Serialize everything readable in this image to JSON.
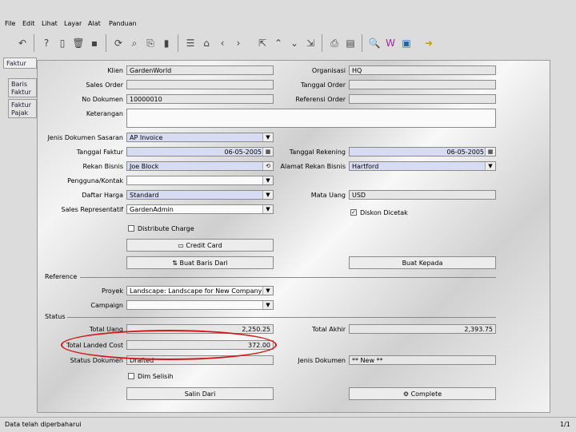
{
  "menu": [
    "File",
    "Edit",
    "Lihat",
    "Layar",
    "Alat",
    "Panduan"
  ],
  "toolbar_icons": [
    "undo-icon",
    "help-icon",
    "new-icon",
    "delete-icon",
    "save-icon",
    "refresh-icon",
    "find-icon",
    "attachment-icon",
    "history-icon",
    "report-icon",
    "archive-icon",
    "previous-icon",
    "parent-icon",
    "up-icon",
    "down-icon",
    "detail-icon",
    "print-icon",
    "print-preview-icon",
    "zoom-icon",
    "workflow-icon",
    "request-icon",
    "exit-icon"
  ],
  "tabs": [
    "Faktur",
    "Baris Faktur",
    "Faktur Pajak"
  ],
  "form": {
    "klien_label": "Klien",
    "klien": "GardenWorld",
    "organisasi_label": "Organisasi",
    "organisasi": "HQ",
    "sales_order_label": "Sales Order",
    "sales_order": "",
    "tanggal_order_label": "Tanggal Order",
    "tanggal_order": "",
    "no_dokumen_label": "No Dokumen",
    "no_dokumen": "10000010",
    "referensi_order_label": "Referensi Order",
    "referensi_order": "",
    "keterangan_label": "Keterangan",
    "keterangan": "",
    "jenis_dokumen_sasaran_label": "Jenis Dokumen Sasaran",
    "jenis_dokumen_sasaran": "AP Invoice",
    "tanggal_faktur_label": "Tanggal Faktur",
    "tanggal_faktur": "06-05-2005",
    "tanggal_rekening_label": "Tanggal Rekening",
    "tanggal_rekening": "06-05-2005",
    "rekan_bisnis_label": "Rekan Bisnis",
    "rekan_bisnis": "Joe Block",
    "alamat_rekan_bisnis_label": "Alamat Rekan Bisnis",
    "alamat_rekan_bisnis": "Hartford",
    "pengguna_kontak_label": "Pengguna/Kontak",
    "pengguna_kontak": "",
    "daftar_harga_label": "Daftar Harga",
    "daftar_harga": "Standard",
    "mata_uang_label": "Mata Uang",
    "mata_uang": "USD",
    "sales_rep_label": "Sales Representatif",
    "sales_rep": "GardenAdmin",
    "diskon_dicetak_label": "Diskon Dicetak",
    "distribute_charge_label": "Distribute Charge",
    "credit_card_label": "Credit Card",
    "buat_baris_dari_label": "Buat Baris Dari",
    "buat_kepada_label": "Buat Kepada",
    "reference_section": "Reference",
    "proyek_label": "Proyek",
    "proyek": "Landscape: Landscape for New Company",
    "campaign_label": "Campaign",
    "campaign": "",
    "status_section": "Status",
    "total_uang_label": "Total Uang",
    "total_uang": "2,250.25",
    "total_akhir_label": "Total Akhir",
    "total_akhir": "2,393.75",
    "total_landed_cost_label": "Total Landed Cost",
    "total_landed_cost": "372.00",
    "status_dokumen_label": "Status Dokumen",
    "status_dokumen": "Drafted",
    "jenis_dokumen_label": "Jenis Dokumen",
    "jenis_dokumen": "** New **",
    "dim_selisih_label": "Dim Selisih",
    "salin_dari_label": "Salin Dari",
    "complete_label": "Complete"
  },
  "status": {
    "message": "Data telah diperbaharui",
    "page": "1/1"
  },
  "colors": {
    "highlight": "#d01818",
    "mandatory": "#d8dcf2"
  }
}
